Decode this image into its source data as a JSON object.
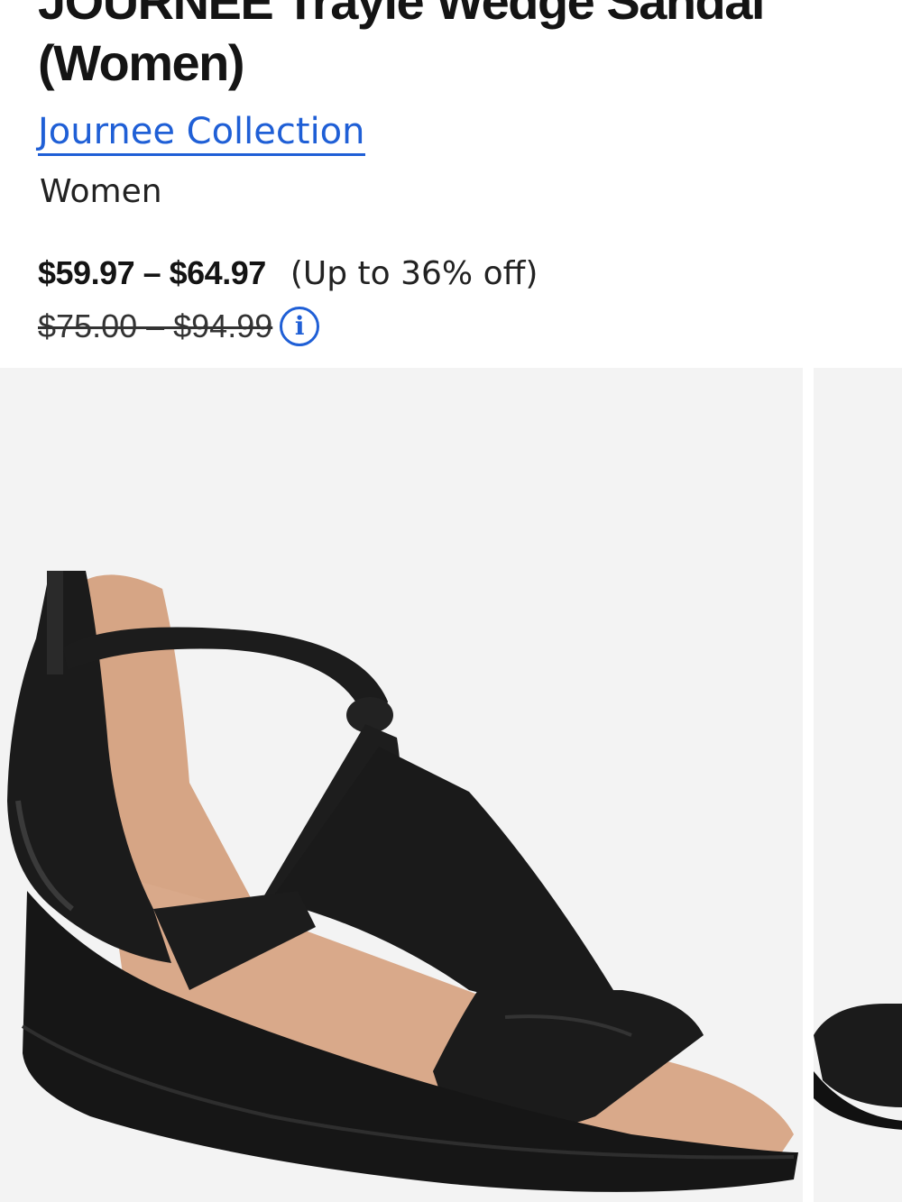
{
  "product": {
    "title_line_1": "JOURNEE Trayle Wedge Sandal",
    "title_line_2": "(Women)",
    "brand": "Journee Collection",
    "category": "Women"
  },
  "pricing": {
    "sale_range": "$59.97 – $64.97",
    "discount_note": "(Up to 36% off)",
    "original_range": "$75.00 – $94.99",
    "info_icon": "info-icon"
  },
  "gallery": {
    "images": [
      {
        "alt": "Black T-strap wedge sandal"
      },
      {
        "alt": "Sandal alternate view"
      }
    ]
  },
  "colors": {
    "link": "#1f5fd6",
    "image_background": "#f3f3f3",
    "sandal_black": "#1b1b1b",
    "footbed_tan": "#d6a585"
  }
}
